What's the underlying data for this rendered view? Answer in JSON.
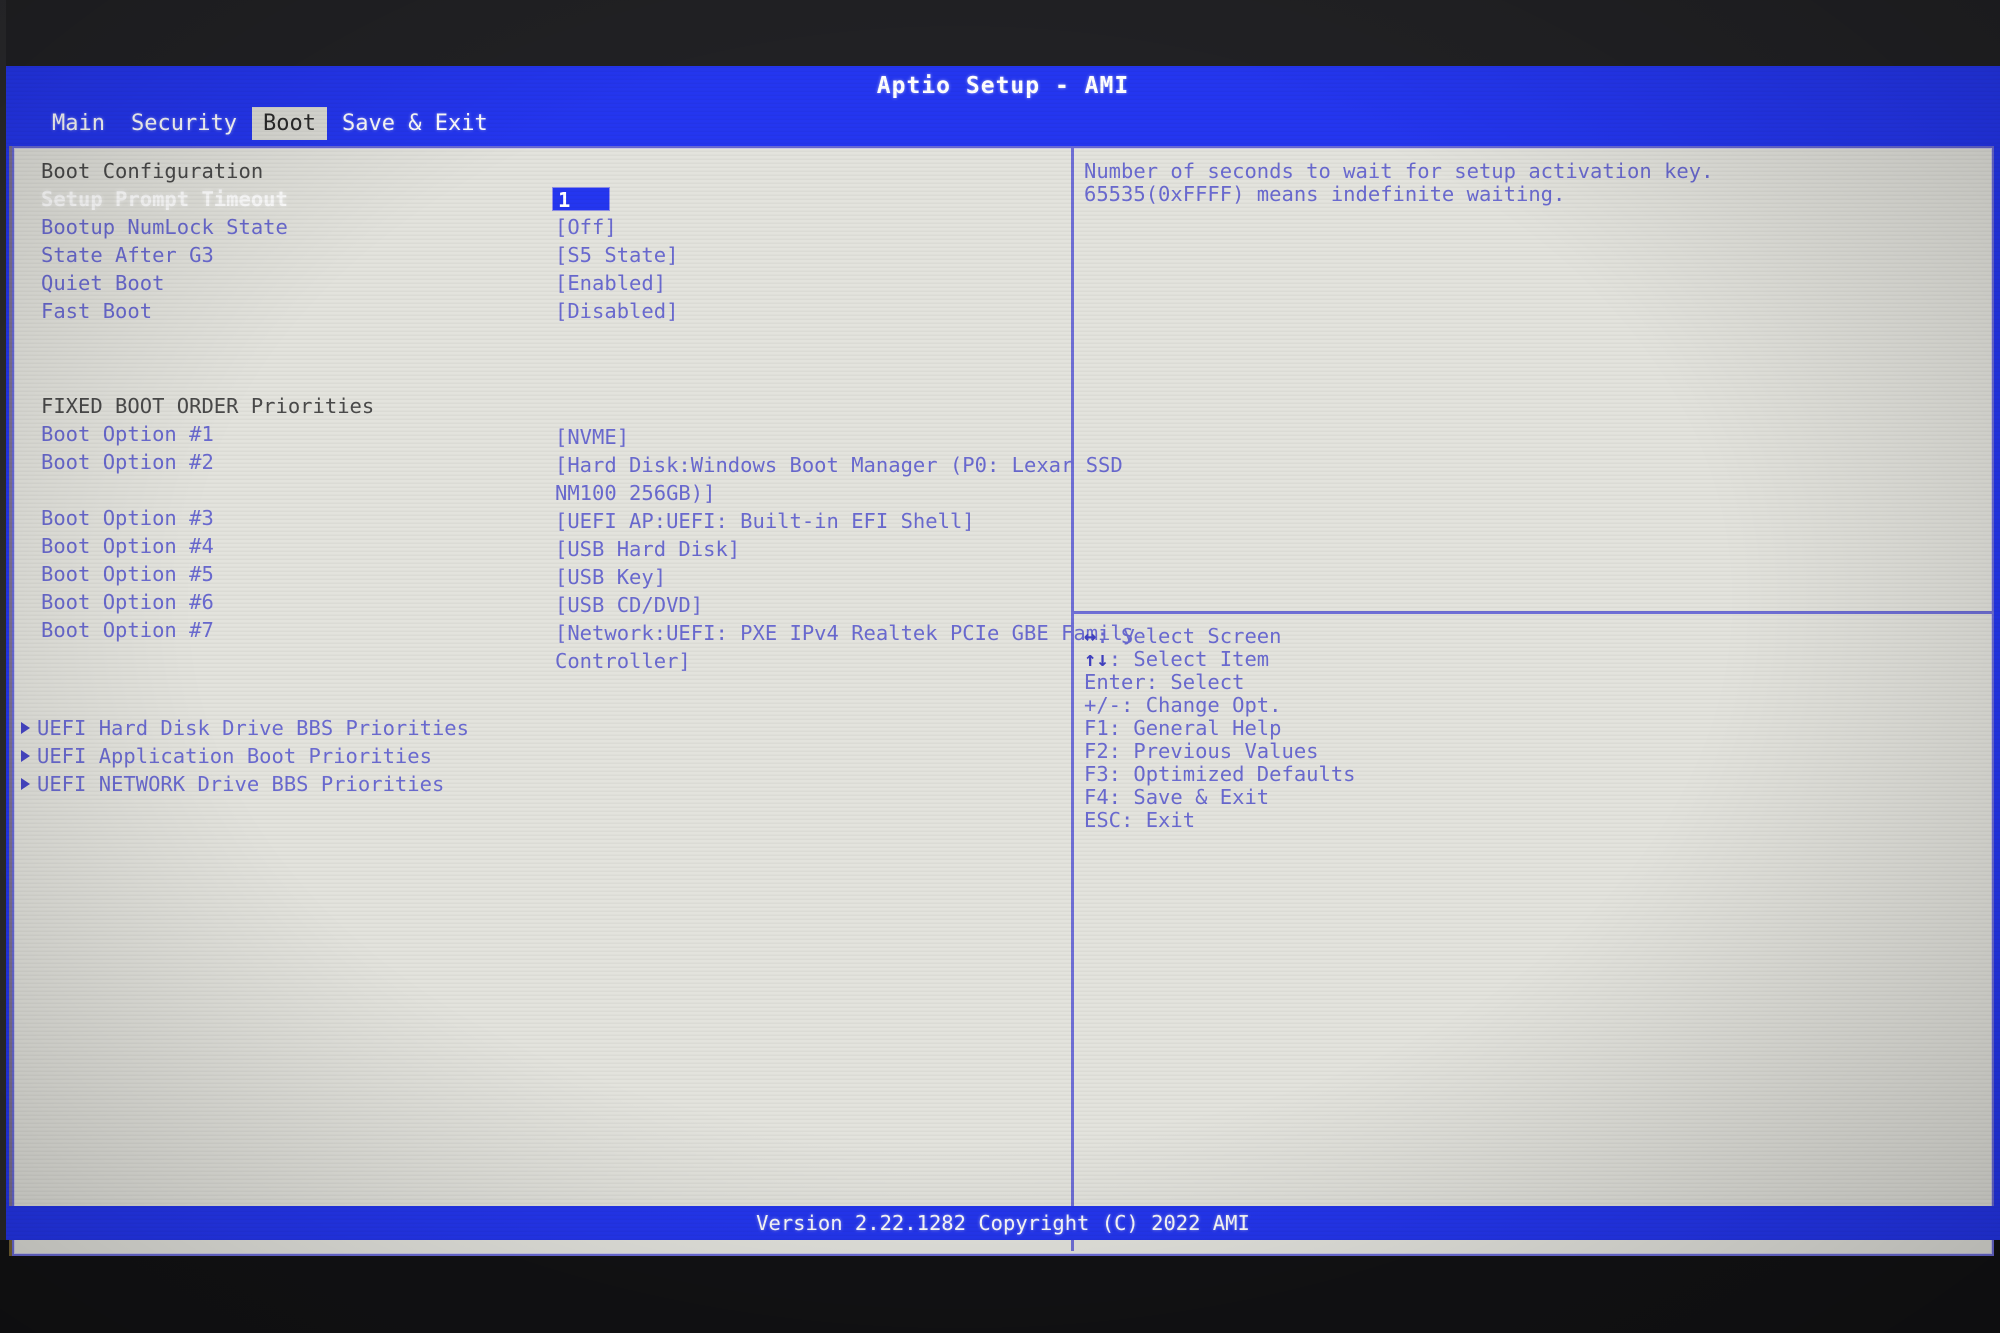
{
  "title": "Aptio Setup - AMI",
  "tabs": [
    {
      "label": "Main",
      "active": false
    },
    {
      "label": "Security",
      "active": false
    },
    {
      "label": "Boot",
      "active": true
    },
    {
      "label": "Save & Exit",
      "active": false
    }
  ],
  "sections": {
    "boot_configuration": {
      "heading": "Boot Configuration",
      "items": [
        {
          "label": "Setup Prompt Timeout",
          "value": "1",
          "selected": true,
          "editable": true
        },
        {
          "label": "Bootup NumLock State",
          "value": "[Off]",
          "selected": false,
          "editable": false
        },
        {
          "label": "State After G3",
          "value": "[S5 State]",
          "selected": false,
          "editable": false
        },
        {
          "label": "Quiet Boot",
          "value": "[Enabled]",
          "selected": false,
          "editable": false
        },
        {
          "label": "Fast Boot",
          "value": "[Disabled]",
          "selected": false,
          "editable": false
        }
      ]
    },
    "fixed_boot_order": {
      "heading": "FIXED BOOT ORDER Priorities",
      "items": [
        {
          "label": "Boot Option #1",
          "value": "[NVME]"
        },
        {
          "label": "Boot Option #2",
          "value": "[Hard Disk:Windows Boot Manager (P0: Lexar SSD\nNM100 256GB)]"
        },
        {
          "label": "Boot Option #3",
          "value": "[UEFI AP:UEFI: Built-in EFI Shell]"
        },
        {
          "label": "Boot Option #4",
          "value": "[USB Hard Disk]"
        },
        {
          "label": "Boot Option #5",
          "value": "[USB Key]"
        },
        {
          "label": "Boot Option #6",
          "value": "[USB CD/DVD]"
        },
        {
          "label": "Boot Option #7",
          "value": "[Network:UEFI: PXE IPv4 Realtek PCIe GBE Family\nController]"
        }
      ]
    },
    "submenus": [
      {
        "label": "UEFI Hard Disk Drive BBS Priorities"
      },
      {
        "label": "UEFI Application Boot Priorities"
      },
      {
        "label": "UEFI NETWORK Drive BBS Priorities"
      }
    ]
  },
  "help": {
    "text": "Number of seconds to wait for setup activation key.\n65535(0xFFFF) means indefinite waiting."
  },
  "legend": [
    {
      "glyph": "↔",
      "text": ": Select Screen"
    },
    {
      "glyph": "↑↓",
      "text": ": Select Item"
    },
    {
      "glyph": "",
      "text": "Enter: Select"
    },
    {
      "glyph": "",
      "text": "+/-: Change Opt."
    },
    {
      "glyph": "",
      "text": "F1: General Help"
    },
    {
      "glyph": "",
      "text": "F2: Previous Values"
    },
    {
      "glyph": "",
      "text": "F3: Optimized Defaults"
    },
    {
      "glyph": "",
      "text": "F4: Save & Exit"
    },
    {
      "glyph": "",
      "text": "ESC: Exit"
    }
  ],
  "footer": {
    "version": "Version 2.22.1282 Copyright (C) 2022 AMI"
  },
  "colors": {
    "screen_blue": "#2436f0",
    "panel_bg": "#e3e3dd",
    "text_blue": "#6a6ad0",
    "heading_gray": "#4a4a4a",
    "selected_white": "#ffffff",
    "border_purple": "#6b6bd8"
  }
}
